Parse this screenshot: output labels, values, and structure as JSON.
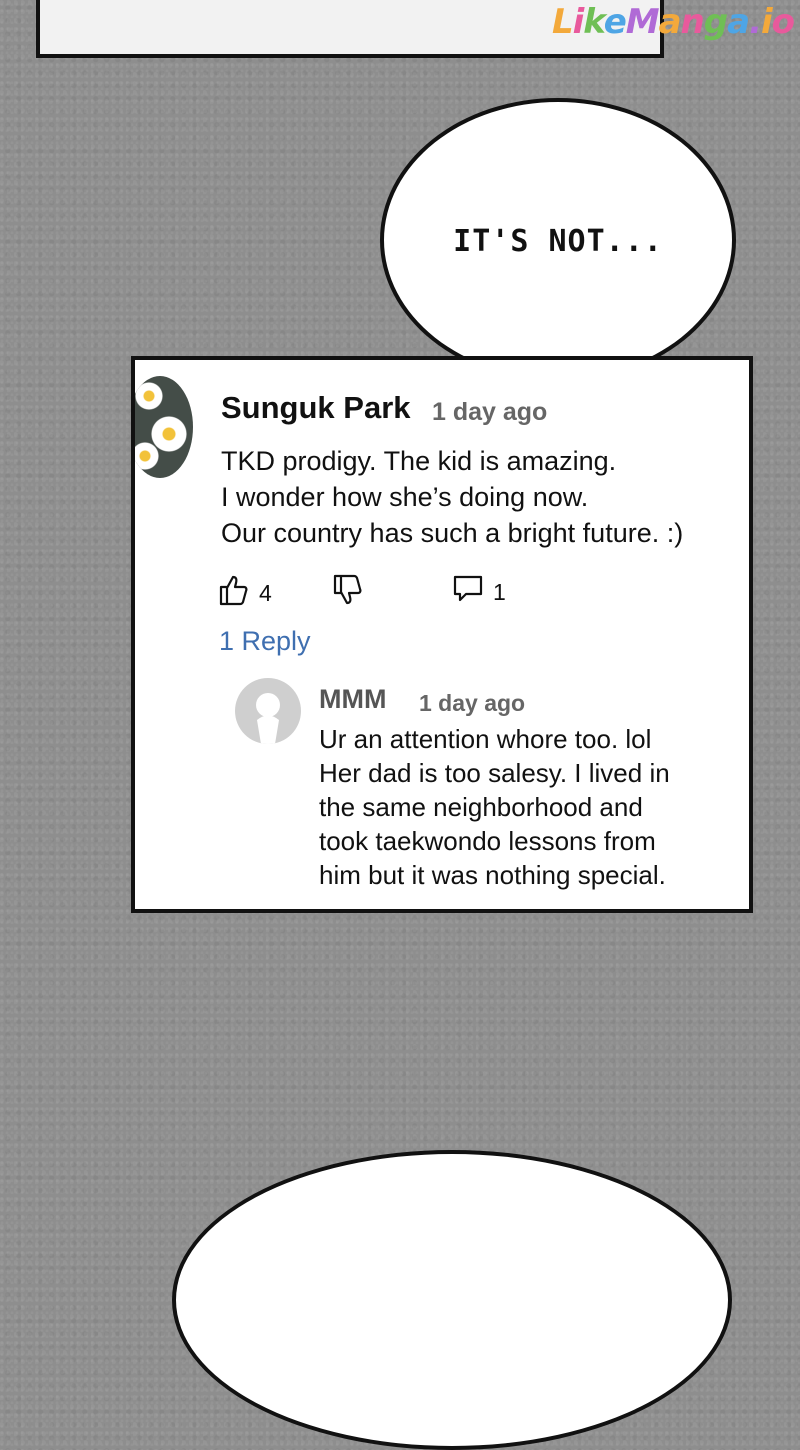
{
  "watermark": {
    "text": "LikeManga.io"
  },
  "bubble": {
    "text": "IT'S NOT..."
  },
  "comment": {
    "author": "Sunguk Park",
    "time": "1 day ago",
    "lines": [
      "TKD prodigy. The kid is amazing.",
      "I wonder how she’s doing now.",
      "Our country has such a bright future. :)"
    ],
    "likes": "4",
    "replies_count": "1",
    "reply_link": "1 Reply",
    "avatar_icon": "daisy-avatar-icon"
  },
  "reply": {
    "author": "MMM",
    "time": "1 day ago",
    "lines": [
      "Ur an attention whore too. lol",
      "Her dad is too salesy. I lived in",
      "the same neighborhood and",
      "took taekwondo lessons from",
      "him but it was nothing special."
    ],
    "avatar_icon": "default-user-avatar-icon"
  },
  "colors": {
    "background": "#8e8e8e",
    "link": "#3f6fb0",
    "border": "#111111"
  }
}
